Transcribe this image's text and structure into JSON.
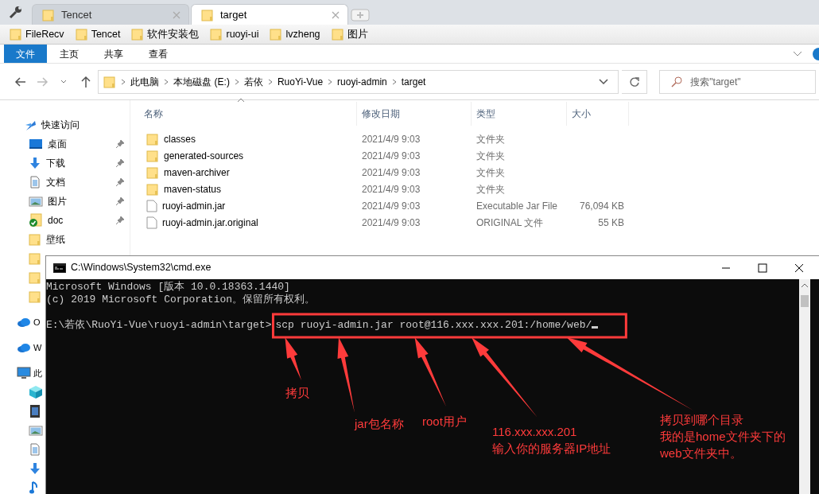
{
  "tabs": [
    {
      "label": "Tencet",
      "selected": false
    },
    {
      "label": "target",
      "selected": true
    }
  ],
  "bookmarks": [
    "FileRecv",
    "Tencet",
    "软件安装包",
    "ruoyi-ui",
    "lvzheng",
    "图片"
  ],
  "ribbon_tabs": [
    {
      "label": "文件",
      "selected": true
    },
    {
      "label": "主页",
      "selected": false
    },
    {
      "label": "共享",
      "selected": false
    },
    {
      "label": "查看",
      "selected": false
    }
  ],
  "address": {
    "segments": [
      "此电脑",
      "本地磁盘 (E:)",
      "若依",
      "RuoYi-Vue",
      "ruoyi-admin",
      "target"
    ]
  },
  "search": {
    "placeholder": "搜索\"target\""
  },
  "sidebar": {
    "items": [
      {
        "label": "快速访问",
        "kind": "star",
        "children": [
          {
            "label": "桌面",
            "kind": "desktop",
            "pinned": true
          },
          {
            "label": "下载",
            "kind": "download",
            "pinned": true
          },
          {
            "label": "文档",
            "kind": "document",
            "pinned": true
          },
          {
            "label": "图片",
            "kind": "pictures",
            "pinned": true
          },
          {
            "label": "doc",
            "kind": "synced-folder",
            "pinned": true
          },
          {
            "label": "壁纸",
            "kind": "folder",
            "pinned": false
          },
          {
            "kind": "folder",
            "pinned": false
          },
          {
            "kind": "folder",
            "pinned": false
          },
          {
            "kind": "folder",
            "pinned": false
          }
        ]
      },
      {
        "label": "O",
        "kind": "cloud"
      },
      {
        "label": "W",
        "kind": "cloud"
      },
      {
        "label": "此",
        "kind": "computer",
        "children": [
          {
            "kind": "cube"
          },
          {
            "kind": "video"
          },
          {
            "kind": "pictures"
          },
          {
            "kind": "document"
          },
          {
            "kind": "download"
          },
          {
            "kind": "music"
          }
        ]
      }
    ]
  },
  "columns": [
    "名称",
    "修改日期",
    "类型",
    "大小"
  ],
  "files": [
    {
      "name": "classes",
      "kind": "folder",
      "modified": "2021/4/9 9:03",
      "type": "文件夹"
    },
    {
      "name": "generated-sources",
      "kind": "folder",
      "modified": "2021/4/9 9:03",
      "type": "文件夹"
    },
    {
      "name": "maven-archiver",
      "kind": "folder",
      "modified": "2021/4/9 9:03",
      "type": "文件夹"
    },
    {
      "name": "maven-status",
      "kind": "folder",
      "modified": "2021/4/9 9:03",
      "type": "文件夹"
    },
    {
      "name": "ruoyi-admin.jar",
      "kind": "file",
      "modified": "2021/4/9 9:03",
      "type": "Executable Jar File",
      "size": "76,094 KB"
    },
    {
      "name": "ruoyi-admin.jar.original",
      "kind": "file",
      "modified": "2021/4/9 9:03",
      "type": "ORIGINAL 文件",
      "size": "55 KB"
    }
  ],
  "console": {
    "title": "C:\\Windows\\System32\\cmd.exe",
    "lines": [
      "Microsoft Windows [版本 10.0.18363.1440]",
      "(c) 2019 Microsoft Corporation。保留所有权利。"
    ],
    "prompt": "E:\\若依\\RuoYi-Vue\\ruoyi-admin\\target>",
    "command": "scp ruoyi-admin.jar root@116.xxx.xxx.201:/home/web/"
  },
  "annotations": [
    {
      "lines": [
        "拷贝"
      ]
    },
    {
      "lines": [
        "jar包名称"
      ]
    },
    {
      "lines": [
        "root用户"
      ]
    },
    {
      "lines": [
        "116.xxx.xxx.201",
        "输入你的服务器IP地址"
      ]
    },
    {
      "lines": [
        "拷贝到哪个目录",
        "我的是home文件夹下的",
        "web文件夹中。"
      ]
    }
  ]
}
